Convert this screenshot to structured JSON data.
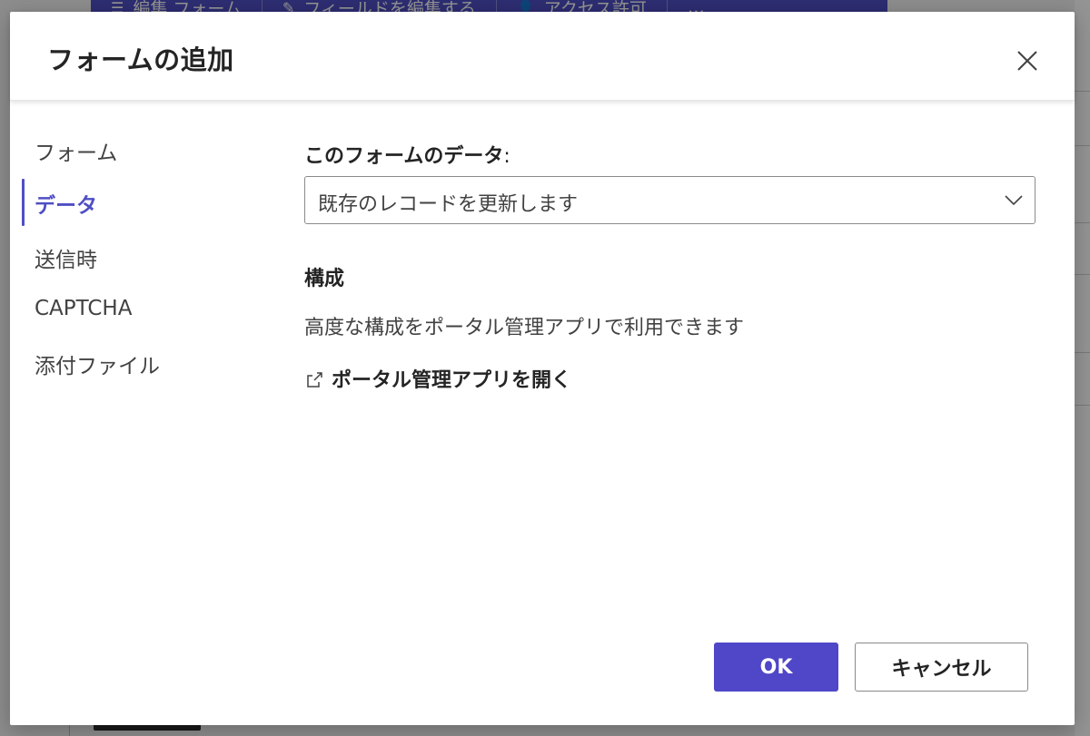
{
  "background": {
    "toolbar_items": [
      {
        "icon": "form-icon",
        "label": "編集 フォーム"
      },
      {
        "icon": "field-edit-icon",
        "label": "フィールドを編集する"
      },
      {
        "icon": "access-icon",
        "label": "アクセス許可"
      },
      {
        "icon": "more-icon",
        "label": "…"
      }
    ]
  },
  "dialog": {
    "title": "フォームの追加",
    "close_icon": "close-icon"
  },
  "nav": {
    "items": [
      {
        "label": "フォーム",
        "active": false
      },
      {
        "label": "データ",
        "active": true
      },
      {
        "label": "送信時",
        "active": false
      },
      {
        "label": "CAPTCHA",
        "active": false
      },
      {
        "label": "添付ファイル",
        "active": false
      }
    ]
  },
  "content": {
    "data_label": "このフォームのデータ",
    "data_colon": ":",
    "data_select_value": "既存のレコードを更新します",
    "config_heading": "構成",
    "config_text": "高度な構成をポータル管理アプリで利用できます",
    "open_link": "ポータル管理アプリを開く"
  },
  "footer": {
    "ok_label": "OK",
    "cancel_label": "キャンセル"
  },
  "colors": {
    "accent": "#4f4fc4",
    "primary_button": "#4f46c8",
    "text": "#242424",
    "muted_text": "#424242"
  }
}
